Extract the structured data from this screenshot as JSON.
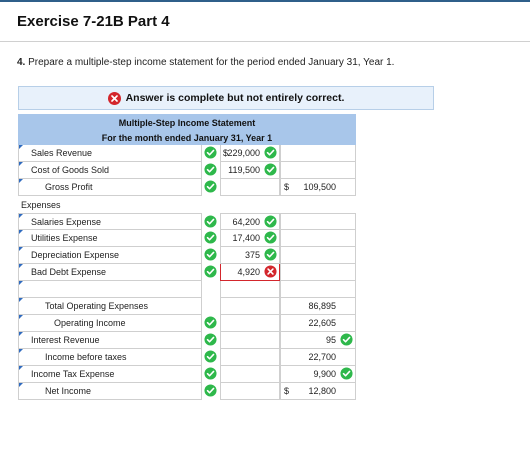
{
  "title": "Exercise 7-21B Part 4",
  "question": {
    "number": "4.",
    "text": "Prepare a multiple-step income statement for the period ended January 31, Year 1."
  },
  "banner": {
    "text": "Answer is complete but not entirely correct."
  },
  "statement": {
    "heading1": "Multiple-Step Income Statement",
    "heading2": "For the month ended January 31, Year 1",
    "rows": [
      {
        "label": "Sales Revenue",
        "col2": "229,000",
        "col2_dollar": "$",
        "col3": ""
      },
      {
        "label": "Cost of Goods Sold",
        "col2": "119,500",
        "col3": ""
      },
      {
        "label": "Gross Profit",
        "col2": "",
        "col3": "109,500",
        "col3_dollar": "$"
      },
      {
        "label": "Expenses",
        "col2": "",
        "col3": ""
      },
      {
        "label": "Salaries Expense",
        "col2": "64,200",
        "col3": ""
      },
      {
        "label": "Utilities Expense",
        "col2": "17,400",
        "col3": ""
      },
      {
        "label": "Depreciation Expense",
        "col2": "375",
        "col3": ""
      },
      {
        "label": "Bad Debt Expense",
        "col2": "4,920",
        "col3": ""
      },
      {
        "label": "",
        "col2": "",
        "col3": ""
      },
      {
        "label": "Total Operating Expenses",
        "col2": "",
        "col3": "86,895"
      },
      {
        "label": "Operating Income",
        "col2": "",
        "col3": "22,605"
      },
      {
        "label": "Interest Revenue",
        "col2": "",
        "col3": "95"
      },
      {
        "label": "Income before taxes",
        "col2": "",
        "col3": "22,700"
      },
      {
        "label": "Income Tax Expense",
        "col2": "",
        "col3": "9,900"
      },
      {
        "label": "Net Income",
        "col2": "",
        "col3": "12,800",
        "col3_dollar": "$"
      }
    ]
  },
  "colors": {
    "correct": "#2eb84b",
    "incorrect": "#d3262c",
    "header": "#a8c6ea",
    "banner_bg": "#e8f1fb"
  }
}
